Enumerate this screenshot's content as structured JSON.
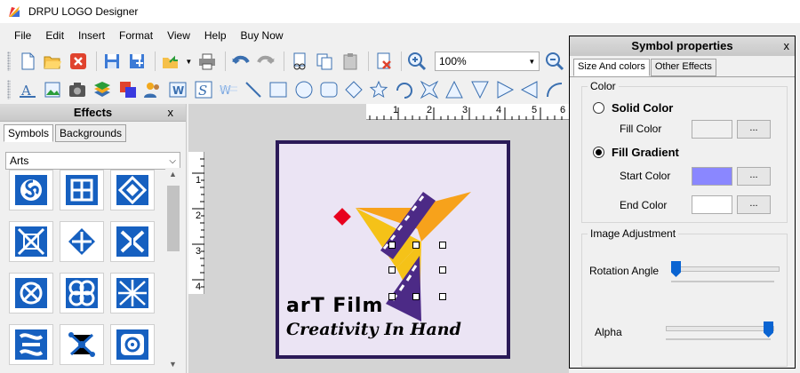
{
  "window": {
    "title": "DRPU LOGO Designer"
  },
  "menu": [
    "File",
    "Edit",
    "Insert",
    "Format",
    "View",
    "Help",
    "Buy Now"
  ],
  "toolbar": {
    "zoom_value": "100%"
  },
  "effects": {
    "title": "Effects",
    "close": "x",
    "tabs": [
      "Symbols",
      "Backgrounds"
    ],
    "category": "Arts"
  },
  "ruler": {
    "h_marks": [
      "1",
      "2",
      "3",
      "4",
      "5",
      "6"
    ],
    "v_marks": [
      "1",
      "2",
      "3",
      "4"
    ]
  },
  "logo": {
    "brand": "arT Film",
    "tagline": "Creativity In Hand"
  },
  "properties": {
    "title": "Symbol properties",
    "close": "x",
    "tabs": [
      "Size And colors",
      "Other Effects"
    ],
    "color_group": "Color",
    "solid_color": "Solid Color",
    "fill_color_label": "Fill Color",
    "fill_gradient": "Fill Gradient",
    "start_color_label": "Start Color",
    "end_color_label": "End Color",
    "browse": "...",
    "image_adjustment": "Image Adjustment",
    "rotation_label": "Rotation Angle",
    "alpha_label": "Alpha",
    "colors": {
      "fill": "#f0f0f0",
      "start": "#8a87ff",
      "end": "#ffffff"
    },
    "rotation_level": 0,
    "alpha_level": 1
  },
  "colors": {
    "accent": "#0a64d2",
    "frame": "#2b1a58",
    "canvas_bg": "#ebe4f4"
  }
}
